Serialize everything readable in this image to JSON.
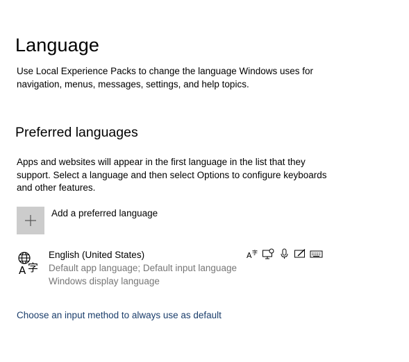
{
  "header": {
    "title": "Language",
    "description": "Use Local Experience Packs to change the language Windows uses for navigation, menus, messages, settings, and help topics."
  },
  "preferred": {
    "title": "Preferred languages",
    "description": "Apps and websites will appear in the first language in the list that they support. Select a language and then select Options to configure keyboards and other features.",
    "add_label": "Add a preferred language"
  },
  "languages": [
    {
      "name": "English (United States)",
      "detail1": "Default app language; Default input language",
      "detail2": "Windows display language",
      "feature_icons": [
        "text-to-speech-icon",
        "display-language-icon",
        "speech-recognition-icon",
        "handwriting-icon",
        "keyboard-icon"
      ]
    }
  ],
  "footer": {
    "link_label": "Choose an input method to always use as default"
  },
  "colors": {
    "add_tile": "#cccccc",
    "secondary_text": "#767676",
    "link": "#1a3d6b"
  }
}
